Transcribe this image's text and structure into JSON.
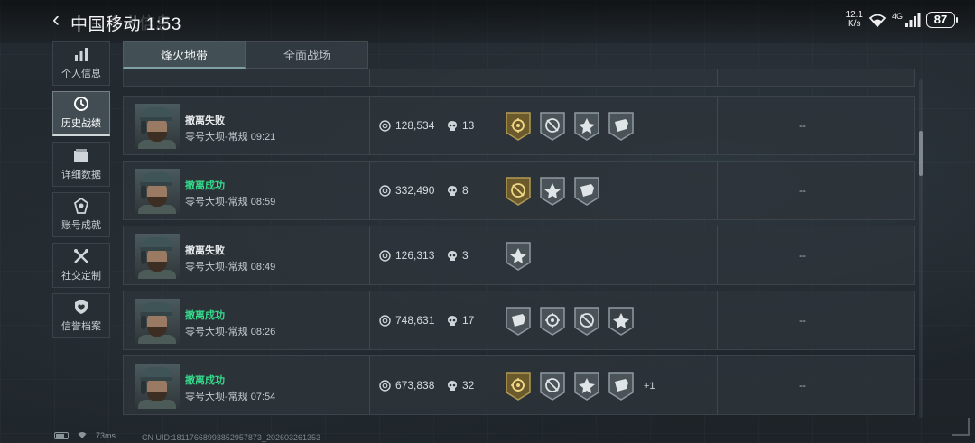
{
  "status_bar": {
    "carrier": "中国移动",
    "time": "1:53",
    "net_speed_value": "12.1",
    "net_speed_unit": "K/s",
    "net_type": "4G",
    "battery": "87",
    "ghost_title": "个人信息"
  },
  "sidebar": {
    "items": [
      {
        "label": "个人信息",
        "icon": "bar-chart-icon",
        "active": false
      },
      {
        "label": "历史战绩",
        "icon": "clock-icon",
        "active": true
      },
      {
        "label": "详细数据",
        "icon": "folder-icon",
        "active": false
      },
      {
        "label": "账号成就",
        "icon": "medal-icon",
        "active": false
      },
      {
        "label": "社交定制",
        "icon": "wrench-cross-icon",
        "active": false
      },
      {
        "label": "信誉档案",
        "icon": "shield-heart-icon",
        "active": false
      }
    ]
  },
  "tabs": [
    {
      "label": "烽火地带",
      "active": true
    },
    {
      "label": "全面战场",
      "active": false
    }
  ],
  "matches": [
    {
      "result": "撤离失败",
      "success": false,
      "map": "零号大坝-常规",
      "time": "09:21",
      "coins": "128,534",
      "kills": "13",
      "badges": [
        "gold",
        "grey",
        "grey",
        "grey"
      ],
      "extra": "",
      "tail": "--"
    },
    {
      "result": "撤离成功",
      "success": true,
      "map": "零号大坝-常规",
      "time": "08:59",
      "coins": "332,490",
      "kills": "8",
      "badges": [
        "gold",
        "grey",
        "grey"
      ],
      "extra": "",
      "tail": "--"
    },
    {
      "result": "撤离失败",
      "success": false,
      "map": "零号大坝-常规",
      "time": "08:49",
      "coins": "126,313",
      "kills": "3",
      "badges": [
        "grey"
      ],
      "extra": "",
      "tail": "--"
    },
    {
      "result": "撤离成功",
      "success": true,
      "map": "零号大坝-常规",
      "time": "08:26",
      "coins": "748,631",
      "kills": "17",
      "badges": [
        "grey",
        "grey",
        "grey",
        "dark"
      ],
      "extra": "",
      "tail": "--"
    },
    {
      "result": "撤离成功",
      "success": true,
      "map": "零号大坝-常规",
      "time": "07:54",
      "coins": "673,838",
      "kills": "32",
      "badges": [
        "gold",
        "grey",
        "grey",
        "grey"
      ],
      "extra": "+1",
      "tail": "--"
    }
  ],
  "footer": {
    "ping": "73ms",
    "uid": "CN UID:18117668993852957873_202603261353"
  },
  "colors": {
    "success": "#35d98a",
    "fail": "#e6e9eb",
    "badge_gold": "#a8904a",
    "badge_grey": "#8c969b"
  }
}
